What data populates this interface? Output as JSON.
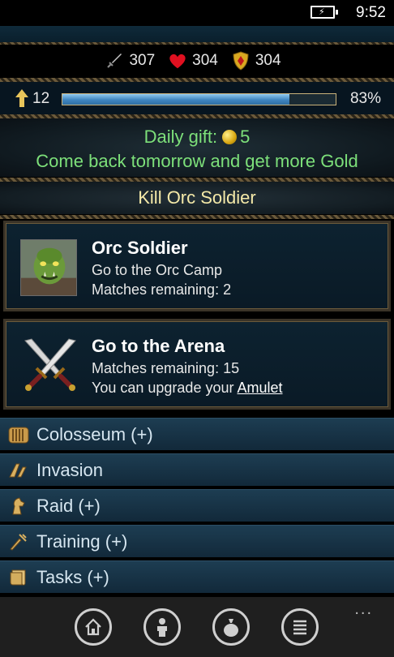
{
  "statusbar": {
    "time": "9:52"
  },
  "stats": {
    "attack": "307",
    "health": "304",
    "defense": "304"
  },
  "level": {
    "value": "12",
    "progress_label": "83%",
    "progress": 0.83
  },
  "gift": {
    "label": "Daily gift:",
    "amount": "5",
    "message": "Come back tomorrow and get more Gold"
  },
  "quest": {
    "title": "Kill Orc Soldier"
  },
  "cards": [
    {
      "title": "Orc Soldier",
      "line1": "Go to the Orc Camp",
      "line2": "Matches remaining: 2"
    },
    {
      "title": "Go to the Arena",
      "line1": "Matches remaining: 15",
      "line2_prefix": "You can upgrade your ",
      "line2_link": "Amulet"
    }
  ],
  "menu": [
    {
      "label": "Colosseum (+)",
      "icon": "colosseum-icon"
    },
    {
      "label": "Invasion",
      "icon": "invasion-icon"
    },
    {
      "label": "Raid (+)",
      "icon": "raid-icon"
    },
    {
      "label": "Training (+)",
      "icon": "training-icon"
    },
    {
      "label": "Tasks (+)",
      "icon": "tasks-icon"
    }
  ],
  "appbar": {
    "more": "..."
  }
}
